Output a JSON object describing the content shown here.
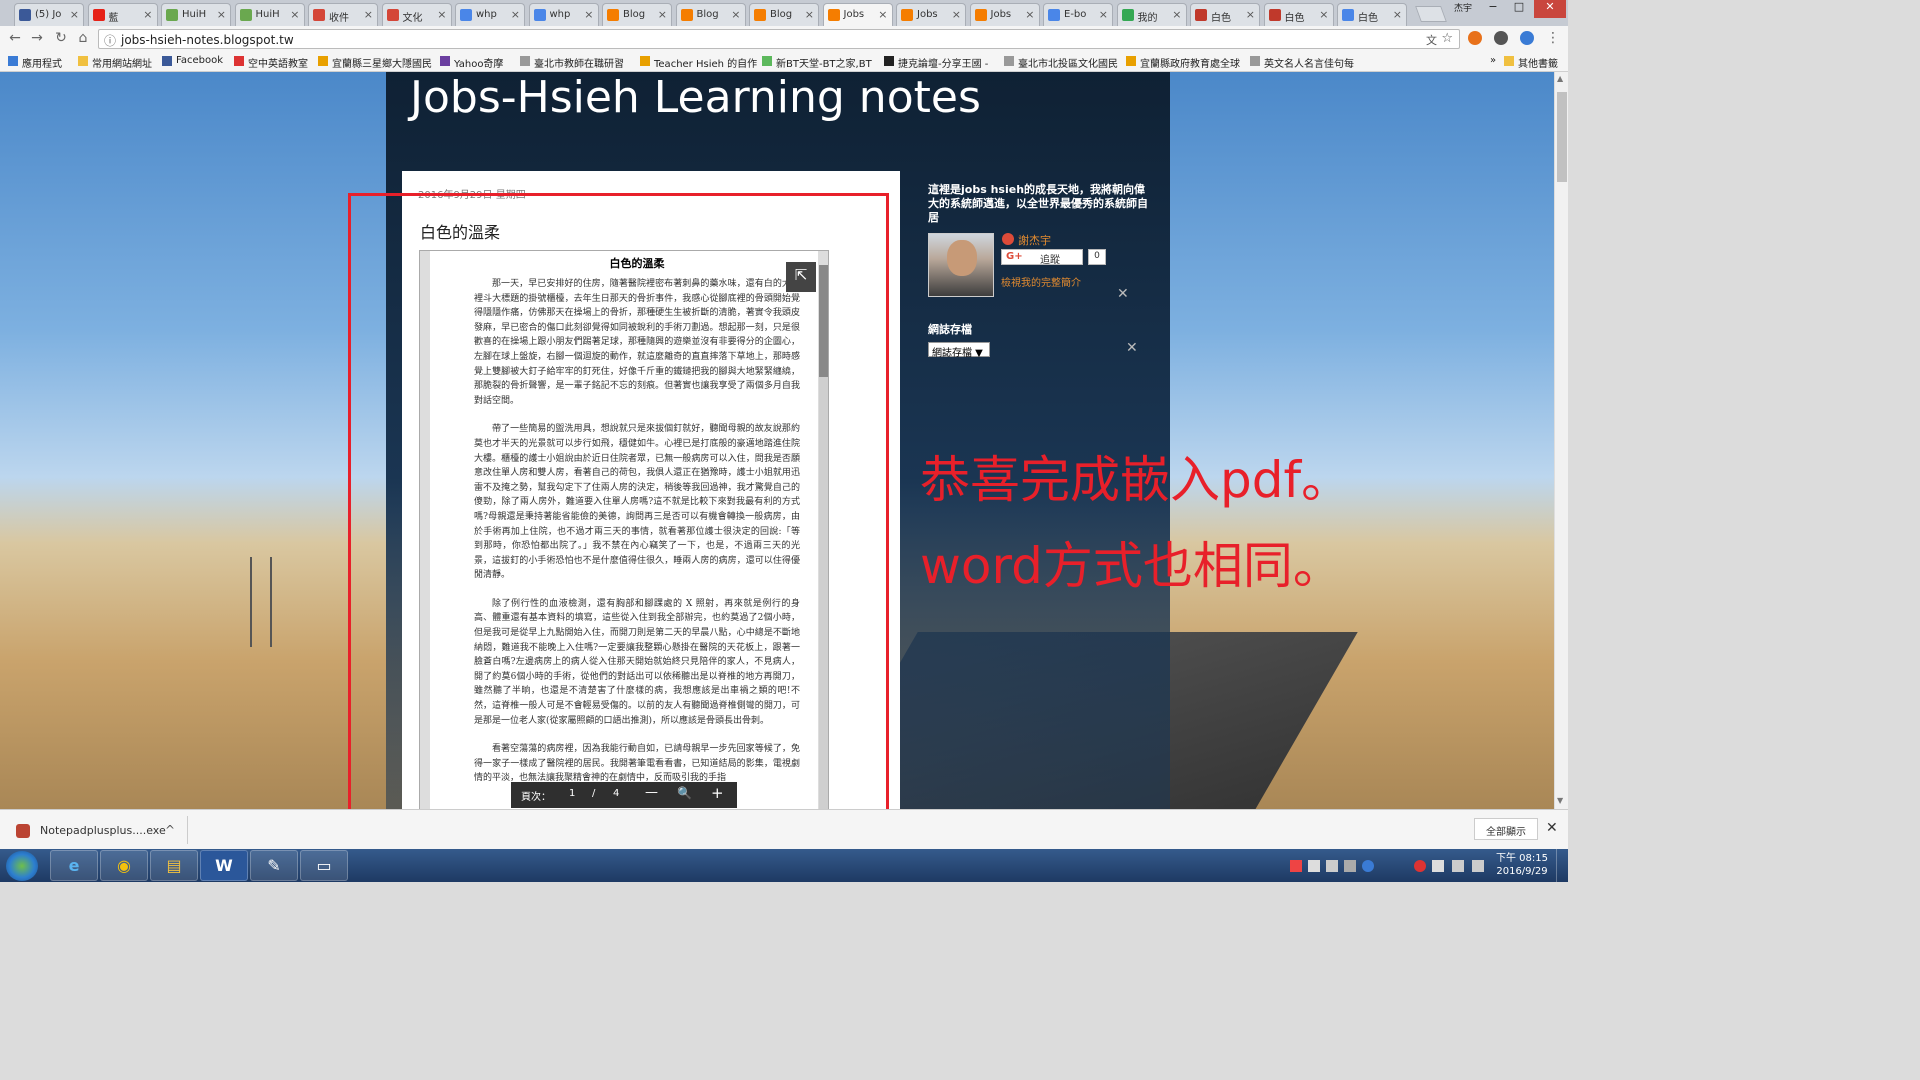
{
  "tabs": [
    {
      "label": "(5) Jo",
      "color": "#3b5998",
      "active": false
    },
    {
      "label": "藍",
      "color": "#e62117",
      "active": false
    },
    {
      "label": "HuiH",
      "color": "#6aa84f",
      "active": false
    },
    {
      "label": "HuiH",
      "color": "#6aa84f",
      "active": false
    },
    {
      "label": "收件",
      "color": "#d44638",
      "active": false
    },
    {
      "label": "文化",
      "color": "#d44638",
      "active": false
    },
    {
      "label": "whp",
      "color": "#4a86e8",
      "active": false
    },
    {
      "label": "whp",
      "color": "#4a86e8",
      "active": false
    },
    {
      "label": "Blog",
      "color": "#f57d00",
      "active": false
    },
    {
      "label": "Blog",
      "color": "#f57d00",
      "active": false
    },
    {
      "label": "Blog",
      "color": "#f57d00",
      "active": false
    },
    {
      "label": "Jobs",
      "color": "#f57d00",
      "active": true
    },
    {
      "label": "Jobs",
      "color": "#f57d00",
      "active": false
    },
    {
      "label": "Jobs",
      "color": "#f57d00",
      "active": false
    },
    {
      "label": "E-bo",
      "color": "#4a86e8",
      "active": false
    },
    {
      "label": "我的",
      "color": "#34a853",
      "active": false
    },
    {
      "label": "白色",
      "color": "#c0392b",
      "active": false
    },
    {
      "label": "白色",
      "color": "#c0392b",
      "active": false
    },
    {
      "label": "白色",
      "color": "#4a86e8",
      "active": false
    }
  ],
  "window": {
    "user": "杰宇",
    "minimize": "−",
    "maximize": "□",
    "close": "✕"
  },
  "address": {
    "url": "jobs-hsieh-notes.blogspot.tw"
  },
  "bookmarks": [
    {
      "label": "應用程式"
    },
    {
      "label": "常用網站網址"
    },
    {
      "label": "Facebook"
    },
    {
      "label": "空中英語教室"
    },
    {
      "label": "宜蘭縣三星鄉大隱國民"
    },
    {
      "label": "Yahoo奇摩"
    },
    {
      "label": "臺北市教師在職研習"
    },
    {
      "label": "Teacher Hsieh 的自作"
    },
    {
      "label": "新BT天堂-BT之家,BT"
    },
    {
      "label": "捷克論壇-分享王國 -"
    },
    {
      "label": "臺北市北投區文化國民"
    },
    {
      "label": "宜蘭縣政府教育處全球"
    },
    {
      "label": "英文名人名言佳句每"
    },
    {
      "label": "»"
    },
    {
      "label": "其他書籤"
    }
  ],
  "blog": {
    "title": "Jobs-Hsieh Learning notes",
    "post_date": "2016年9月29日 星期四",
    "post_title": "白色的溫柔"
  },
  "pdf": {
    "heading": "白色的溫柔",
    "paragraphs": [
      "那一天，早已安排好的住房，隨著醫院裡密布著刺鼻的藥水味，還有白的大廳裡斗大標題的掛號櫃檯，去年生日那天的骨折事件，我感心從腳底裡的骨頭開始覺得隱隱作痛，仿佛那天在操場上的骨折，那種硬生生被折斷的清脆，著實令我頭皮發麻，早已密合的傷口此刻卻覺得如同被銳利的手術刀劃過。想起那一刻，只是很歡喜的在操場上跟小朋友們踢著足球，那種隨興的遊樂並沒有非要得分的企圖心，左腳在球上盤旋，右腳一個迴旋的動作，就這麼離奇的直直摔落下草地上，那時感覺上雙腳被大釘子給牢牢的釘死住，好像千斤重的鐵鏈把我的腳與大地緊緊纏繞，那脆裂的骨折聲響，是一輩子銘記不忘的刻痕。但著實也讓我享受了兩個多月自我對話空間。",
      "帶了一些簡易的盥洗用具，想說就只是來拔個釘就好，聽聞母親的故友說那約莫也才半天的光景就可以步行如飛，穩健如牛。心裡已是打底般的豪邁地踏進住院大樓。櫃檯的護士小姐說由於近日住院者眾，已無一般病房可以入住，問我是否願意改住單人房和雙人房，看著自己的荷包，我俱人還正在猶豫時，護士小姐就用迅雷不及掩之勢，幫我勾定下了住兩人房的決定，稍後等我回過神，我才驚覺自己的傻勁，除了兩人房外，難道要入住單人房嗎?這不就是比較下來對我最有利的方式嗎?母親還是秉持著能省能儉的美德，詢問再三是否可以有機會轉換一般病房，由於手術再加上住院，也不過才兩三天的事情，就看著那位護士很決定的回說:「等到那時，你恐怕都出院了。」我不禁在內心竊笑了一下，也是，不過兩三天的光景，這拔釘的小手術恐怕也不是什麼值得住很久，睡兩人房的病房，還可以住得優閒清靜。",
      "除了例行性的血液檢測，還有胸部和腳踝處的 X 照射，再來就是例行的身高、體重還有基本資料的填寫，這些從入住到我全部辦完，也約莫過了2個小時，但是我可是從早上九點開始入住，而開刀則是第二天的早晨八點，心中總是不斷地納悶，難道我不能晚上入住嗎?一定要讓我整顆心懸掛在醫院的天花板上，跟著一臉蒼白嗎?左邊病房上的病人從入住那天開始就始終只見陪伴的家人，不見病人，開了約莫6個小時的手術，從他們的對話出可以依稀聽出是以脊椎的地方再開刀，雖然聽了半晌，也還是不清楚害了什麼樣的病，我想應該是出車禍之類的吧!不然，這脊椎一般人可是不會輕易受傷的。以前的友人有聽聞過脊椎側彎的開刀，可是那是一位老人家(從家屬照顧的口語出推測)，所以應該是骨頭長出骨刺。",
      "看著空蕩蕩的病房裡，因為我能行動自如，已請母親早一步先回家等候了，免得一家子一樣成了醫院裡的居民。我開著筆電看看書，已知道結局的影集，電視劇情的平淡，也無法讓我聚精會神的在劇情中，反而吸引我的手指"
    ],
    "page_label": "頁次：",
    "page_current": "1",
    "page_sep": "/",
    "page_total": "4",
    "zoom_out": "—",
    "zoom_icon": "🔍",
    "zoom_in": "+"
  },
  "sidebar": {
    "about": "這裡是jobs hsieh的成長天地，我將朝向偉大的系統師邁進，以全世界最優秀的系統師自居",
    "profile_name": "謝杰宇",
    "follow_label": "追蹤",
    "follower_count": "0",
    "profile_link": "檢視我的完整簡介",
    "archive_heading": "網誌存檔",
    "archive_select": "網誌存檔 ▼"
  },
  "annotation": {
    "line1": "恭喜完成嵌入pdf。",
    "line2": "word方式也相同。",
    "color": "#e8202a"
  },
  "downloads": {
    "file": "Notepadplusplus....exe",
    "show_all": "全部顯示",
    "close": "✕"
  },
  "taskbar": {
    "apps": [
      "e",
      "◉",
      "▤",
      "W",
      "✎",
      "▭"
    ],
    "time": "下午 08:15",
    "date": "2016/9/29"
  }
}
